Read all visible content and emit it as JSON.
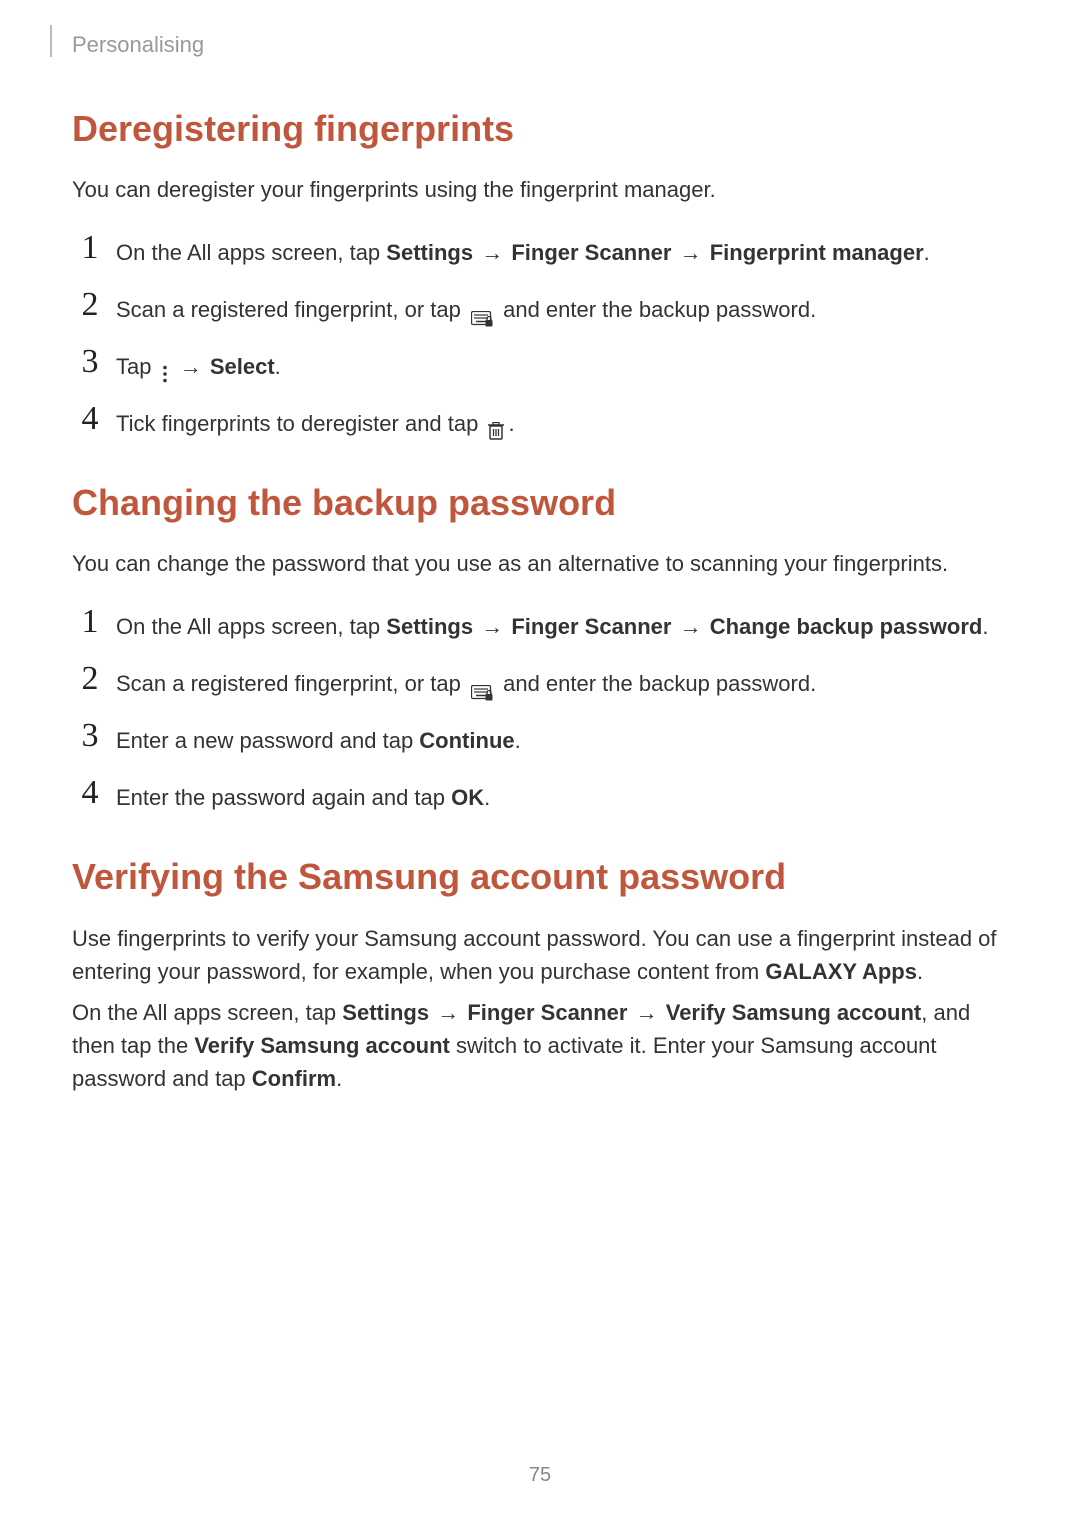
{
  "breadcrumb": "Personalising",
  "page_number": "75",
  "sections": {
    "deregister": {
      "heading": "Deregistering fingerprints",
      "intro": "You can deregister your fingerprints using the fingerprint manager.",
      "steps": {
        "s1_pre": "On the All apps screen, tap ",
        "s1_b1": "Settings",
        "s1_b2": "Finger Scanner",
        "s1_b3": "Fingerprint manager",
        "s2_a": "Scan a registered fingerprint, or tap ",
        "s2_b": " and enter the backup password.",
        "s3_a": "Tap ",
        "s3_b": "Select",
        "s4_a": "Tick fingerprints to deregister and tap "
      }
    },
    "backup": {
      "heading": "Changing the backup password",
      "intro": "You can change the password that you use as an alternative to scanning your fingerprints.",
      "steps": {
        "s1_pre": "On the All apps screen, tap ",
        "s1_b1": "Settings",
        "s1_b2": "Finger Scanner",
        "s1_b3": "Change backup password",
        "s2_a": "Scan a registered fingerprint, or tap ",
        "s2_b": " and enter the backup password.",
        "s3_a": "Enter a new password and tap ",
        "s3_b": "Continue",
        "s4_a": "Enter the password again and tap ",
        "s4_b": "OK"
      }
    },
    "verify": {
      "heading": "Verifying the Samsung account password",
      "para1_a": "Use fingerprints to verify your Samsung account password. You can use a fingerprint instead of entering your password, for example, when you purchase content from ",
      "para1_b": "GALAXY Apps",
      "para2_a": "On the All apps screen, tap ",
      "para2_b1": "Settings",
      "para2_b2": "Finger Scanner",
      "para2_b3": "Verify Samsung account",
      "para2_c": ", and then tap the ",
      "para2_b4": "Verify Samsung account",
      "para2_d": " switch to activate it. Enter your Samsung account password and tap ",
      "para2_b5": "Confirm"
    }
  },
  "arrow": "→",
  "period": "."
}
